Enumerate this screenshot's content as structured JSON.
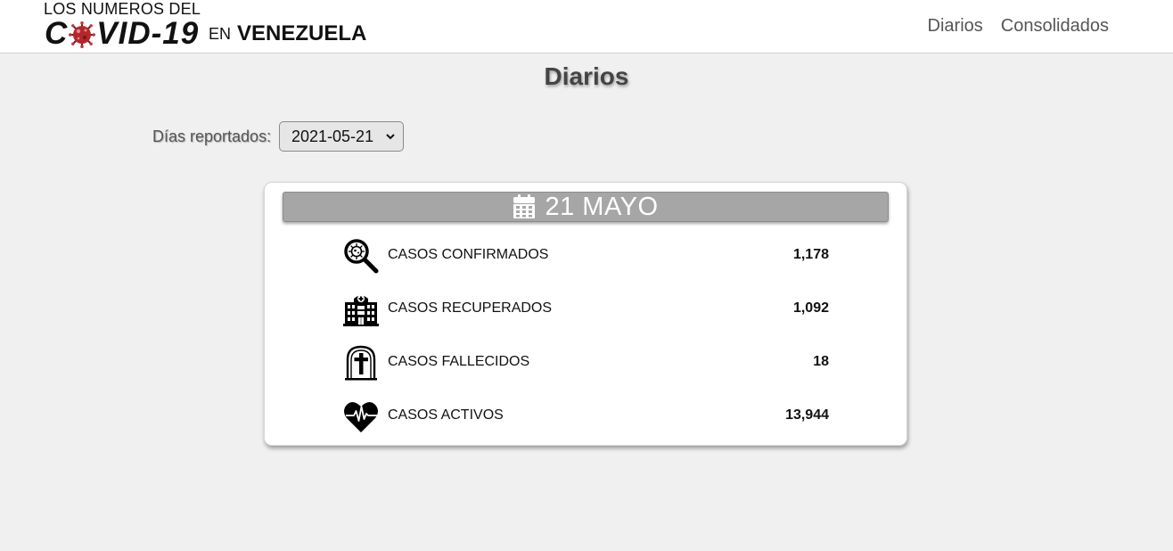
{
  "brand": {
    "top_line": "LOS NUMEROS DEL",
    "covid_prefix": "C",
    "covid_suffix": "VID-19",
    "en": "EN",
    "country": "VENEZUELA"
  },
  "nav": {
    "items": [
      {
        "label": "Diarios"
      },
      {
        "label": "Consolidados"
      }
    ]
  },
  "page": {
    "title": "Diarios"
  },
  "filter": {
    "label": "Días reportados:",
    "selected": "2021-05-21"
  },
  "card": {
    "date": "21 MAYO",
    "icon": "calendar-icon",
    "rows": [
      {
        "icon": "virus-magnifier-icon",
        "label": "CASOS CONFIRMADOS",
        "value": "1,178"
      },
      {
        "icon": "hospital-icon",
        "label": "CASOS RECUPERADOS",
        "value": "1,092"
      },
      {
        "icon": "tombstone-icon",
        "label": "CASOS FALLECIDOS",
        "value": "18"
      },
      {
        "icon": "heart-pulse-icon",
        "label": "CASOS ACTIVOS",
        "value": "13,944"
      }
    ]
  },
  "colors": {
    "background": "#f0f0f0",
    "header_bar": "#a6a6a6",
    "virus_red": "#b3262b"
  }
}
